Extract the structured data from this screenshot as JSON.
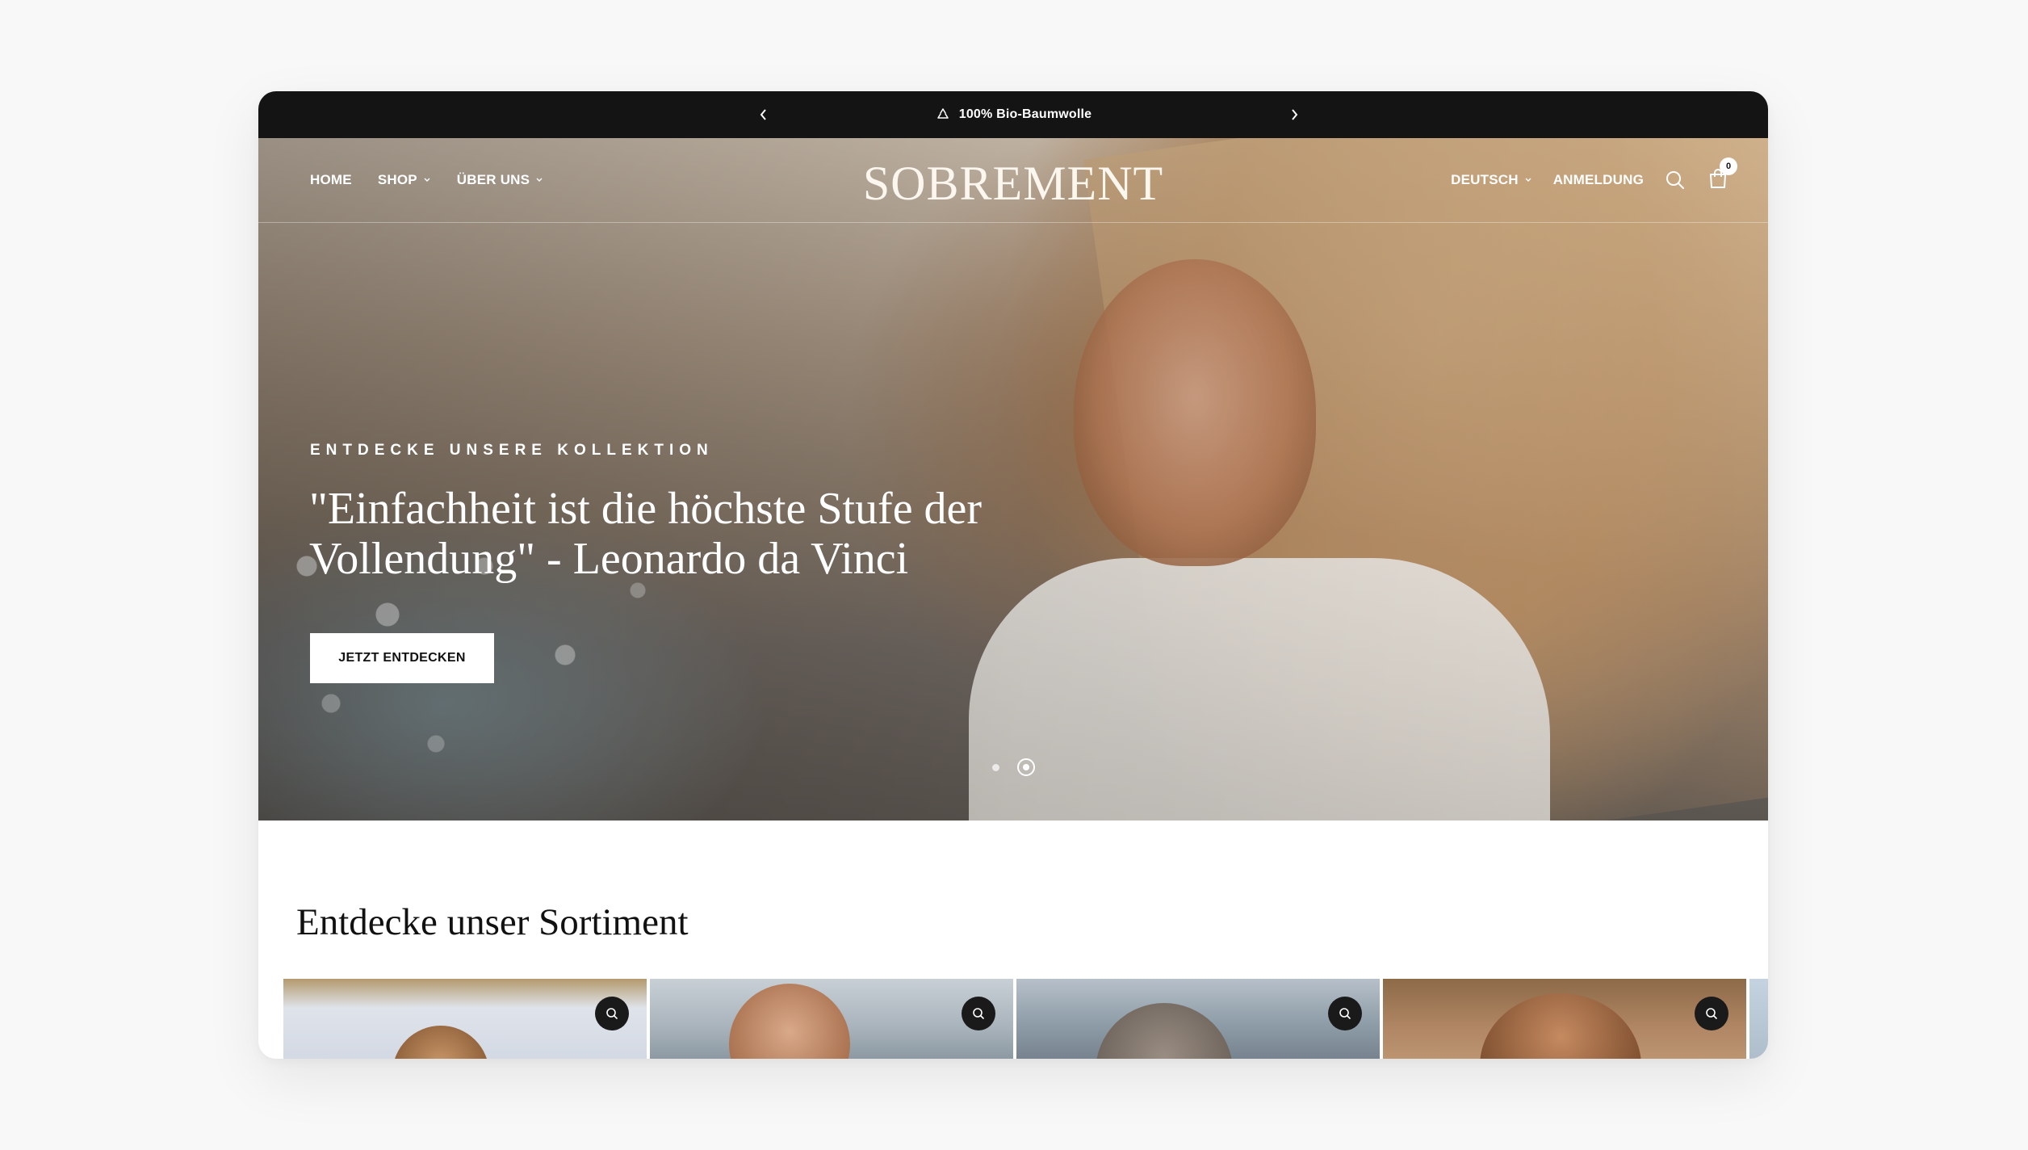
{
  "announcement": {
    "message": "100% Bio-Baumwolle",
    "icon": "recycle-icon"
  },
  "header": {
    "nav": [
      {
        "label": "HOME",
        "has_dropdown": false
      },
      {
        "label": "SHOP",
        "has_dropdown": true
      },
      {
        "label": "ÜBER UNS",
        "has_dropdown": true
      }
    ],
    "logo": "SOBREMENT",
    "language": "DEUTSCH",
    "login": "ANMELDUNG",
    "cart_count": "0"
  },
  "hero": {
    "eyebrow": "ENTDECKE UNSERE KOLLEKTION",
    "headline": "\"Einfachheit ist die höchste Stufe der Vollendung\" - Leonardo da Vinci",
    "cta": "JETZT ENTDECKEN",
    "slides": 2,
    "active_slide": 2
  },
  "section": {
    "title": "Entdecke unser Sortiment"
  },
  "colors": {
    "announcement_bg": "#141414",
    "text_dark": "#111111",
    "page_bg": "#f8f8f8"
  }
}
